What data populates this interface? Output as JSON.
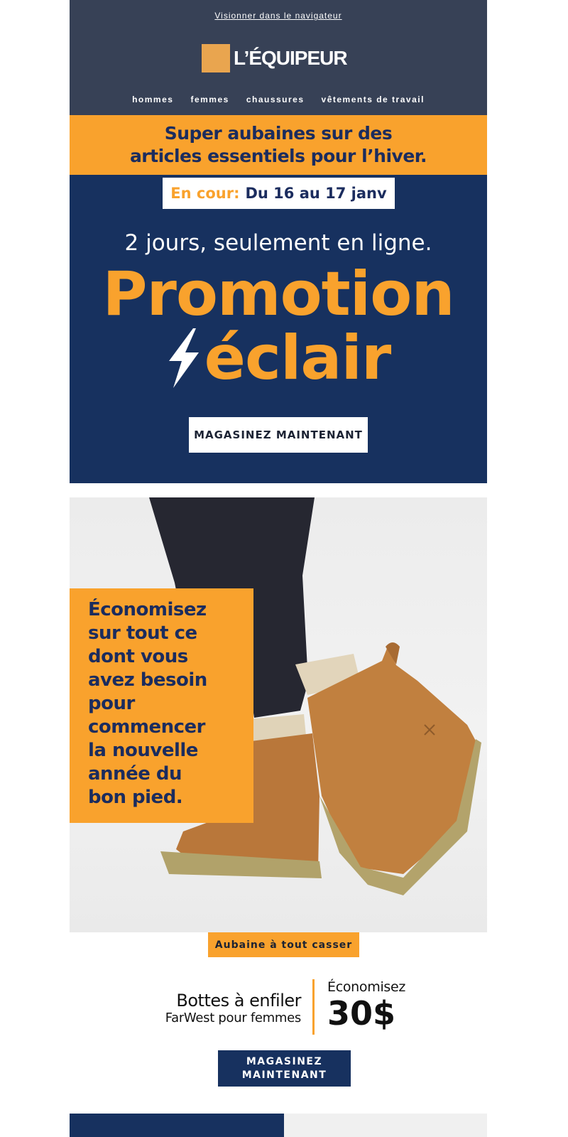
{
  "header": {
    "view_in_browser": "Visionner dans le navigateur",
    "logo_text": "L’ÉQUIPEUR",
    "nav": [
      "hommes",
      "femmes",
      "chaussures",
      "vêtements de travail"
    ]
  },
  "banner": {
    "line1": "Super aubaines sur des",
    "line2": "articles essentiels pour l’hiver."
  },
  "promo": {
    "date_prefix": "En cour:",
    "date_range": "Du 16 au 17 janv",
    "subtitle": "2 jours, seulement en ligne.",
    "title_line1": "Promotion",
    "title_line2": "éclair",
    "cta": "MAGASINEZ MAINTENANT"
  },
  "hero": {
    "text": "Économisez sur tout ce dont vous avez besoin pour commencer la nouvelle année du bon pied."
  },
  "product": {
    "badge": "Aubaine à tout casser",
    "name": "Bottes à enfiler",
    "subtitle": "FarWest pour femmes",
    "save_label": "Économisez",
    "save_amount": "30$",
    "cta_line1": "MAGASINEZ",
    "cta_line2": "MAINTENANT"
  },
  "colors": {
    "navy": "#17315f",
    "slate": "#374156",
    "orange": "#f9a22d",
    "white": "#ffffff"
  }
}
